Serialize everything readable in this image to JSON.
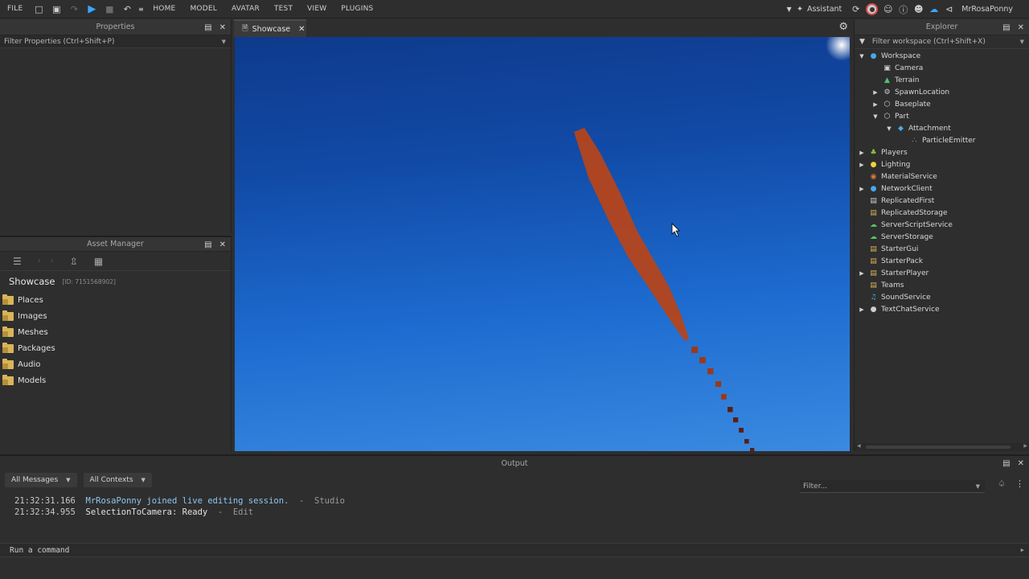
{
  "menu": [
    "FILE",
    "HOME",
    "MODEL",
    "AVATAR",
    "TEST",
    "VIEW",
    "PLUGINS"
  ],
  "topbar": {
    "assistant_label": "Assistant",
    "user_name": "MrRosaPonny"
  },
  "properties": {
    "title": "Properties",
    "filter_placeholder": "Filter Properties (Ctrl+Shift+P)"
  },
  "asset_manager": {
    "title": "Asset Manager",
    "place_name": "Showcase",
    "place_id": "[ID: 7151568902]",
    "folders": [
      "Places",
      "Images",
      "Meshes",
      "Packages",
      "Audio",
      "Models"
    ]
  },
  "viewport": {
    "tab_label": "Showcase"
  },
  "explorer": {
    "title": "Explorer",
    "filter_placeholder": "Filter workspace (Ctrl+Shift+X)",
    "items": [
      {
        "label": "Workspace",
        "depth": 0,
        "arrow": "open",
        "icon": "workspace-icon",
        "color": "#4aa8e8"
      },
      {
        "label": "Camera",
        "depth": 1,
        "arrow": "none",
        "icon": "camera-icon",
        "color": "#cfcfcf"
      },
      {
        "label": "Terrain",
        "depth": 1,
        "arrow": "none",
        "icon": "terrain-icon",
        "color": "#4fc46a"
      },
      {
        "label": "SpawnLocation",
        "depth": 1,
        "arrow": "closed",
        "icon": "spawn-icon",
        "color": "#cfcfcf"
      },
      {
        "label": "Baseplate",
        "depth": 1,
        "arrow": "closed",
        "icon": "part-icon",
        "color": "#cfcfcf"
      },
      {
        "label": "Part",
        "depth": 1,
        "arrow": "open",
        "icon": "part-icon",
        "color": "#cfcfcf"
      },
      {
        "label": "Attachment",
        "depth": 2,
        "arrow": "open",
        "icon": "attachment-icon",
        "color": "#4aa8e8"
      },
      {
        "label": "ParticleEmitter",
        "depth": 3,
        "arrow": "none",
        "icon": "particle-emitter-icon",
        "color": "#6aa0d8"
      },
      {
        "label": "Players",
        "depth": 0,
        "arrow": "closed",
        "icon": "players-icon",
        "color": "#8cc63f"
      },
      {
        "label": "Lighting",
        "depth": 0,
        "arrow": "closed",
        "icon": "lighting-icon",
        "color": "#f2d13a"
      },
      {
        "label": "MaterialService",
        "depth": 0,
        "arrow": "none",
        "icon": "material-service-icon",
        "color": "#e07b39"
      },
      {
        "label": "NetworkClient",
        "depth": 0,
        "arrow": "closed",
        "icon": "network-client-icon",
        "color": "#4aa8e8"
      },
      {
        "label": "ReplicatedFirst",
        "depth": 0,
        "arrow": "none",
        "icon": "replicated-first-icon",
        "color": "#cfcfcf"
      },
      {
        "label": "ReplicatedStorage",
        "depth": 0,
        "arrow": "none",
        "icon": "replicated-storage-icon",
        "color": "#d9b458"
      },
      {
        "label": "ServerScriptService",
        "depth": 0,
        "arrow": "none",
        "icon": "server-script-service-icon",
        "color": "#4fc46a"
      },
      {
        "label": "ServerStorage",
        "depth": 0,
        "arrow": "none",
        "icon": "server-storage-icon",
        "color": "#4fc46a"
      },
      {
        "label": "StarterGui",
        "depth": 0,
        "arrow": "none",
        "icon": "starter-gui-icon",
        "color": "#d9b458"
      },
      {
        "label": "StarterPack",
        "depth": 0,
        "arrow": "none",
        "icon": "starter-pack-icon",
        "color": "#d9b458"
      },
      {
        "label": "StarterPlayer",
        "depth": 0,
        "arrow": "closed",
        "icon": "starter-player-icon",
        "color": "#d9b458"
      },
      {
        "label": "Teams",
        "depth": 0,
        "arrow": "none",
        "icon": "teams-icon",
        "color": "#d9b458"
      },
      {
        "label": "SoundService",
        "depth": 0,
        "arrow": "none",
        "icon": "sound-service-icon",
        "color": "#4aa8e8"
      },
      {
        "label": "TextChatService",
        "depth": 0,
        "arrow": "closed",
        "icon": "text-chat-service-icon",
        "color": "#cfcfcf"
      }
    ]
  },
  "output": {
    "title": "Output",
    "messages_filter": "All Messages",
    "contexts_filter": "All Contexts",
    "filter_placeholder": "Filter...",
    "lines": [
      {
        "time": "21:32:31.166",
        "text": "MrRosaPonny joined live editing session.",
        "source": "Studio",
        "color": "#8fc6f0"
      },
      {
        "time": "21:32:34.955",
        "text": "SelectionToCamera: Ready",
        "source": "Edit",
        "color": "#e2e2e2"
      }
    ]
  },
  "command_bar": {
    "placeholder": "Run a command"
  }
}
